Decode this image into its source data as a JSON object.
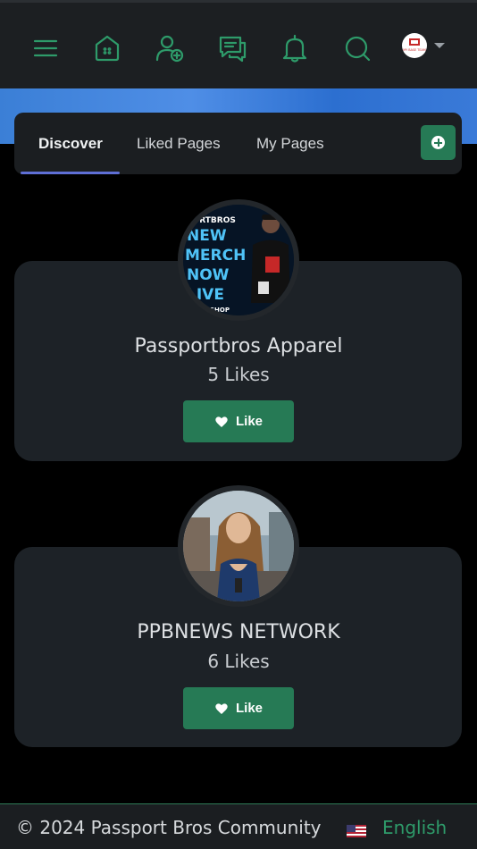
{
  "nav": {
    "icons": [
      "menu-icon",
      "home-icon",
      "add-user-icon",
      "messages-icon",
      "bell-icon",
      "search-icon"
    ],
    "account_avatar_text": "MY BASE TEAM"
  },
  "tabs": {
    "items": [
      {
        "label": "Discover",
        "active": true
      },
      {
        "label": "Liked Pages",
        "active": false
      },
      {
        "label": "My Pages",
        "active": false
      }
    ],
    "add_icon": "plus-circle-icon"
  },
  "pages": [
    {
      "name": "Passportbros Apparel",
      "likes": "5 Likes",
      "like_label": "Like",
      "avatar_text": [
        "PORTBROS",
        "NEW",
        "MERCH",
        "NOW",
        "LIVE",
        "SHOP"
      ]
    },
    {
      "name": "PPBNEWS NETWORK",
      "likes": "6 Likes",
      "like_label": "Like"
    }
  ],
  "footer": {
    "copyright": "© 2024 Passport Bros Community",
    "language": "English",
    "flag_icon": "us-flag-icon"
  },
  "colors": {
    "accent": "#2e9b6a",
    "button": "#267a55",
    "tab_underline": "#5f6fd6",
    "banner": "#3b7fd6",
    "card": "#1d2227"
  }
}
